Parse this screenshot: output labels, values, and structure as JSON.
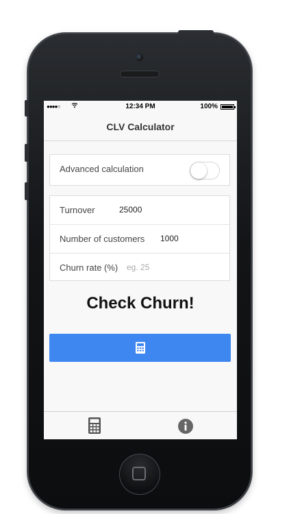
{
  "status_bar": {
    "signal": "●●●●○",
    "time": "12:34 PM",
    "battery": "100%"
  },
  "nav": {
    "title": "CLV Calculator"
  },
  "advanced": {
    "label": "Advanced calculation",
    "enabled": false
  },
  "form": {
    "turnover": {
      "label": "Turnover",
      "value": "25000"
    },
    "customers": {
      "label": "Number of customers",
      "value": "1000"
    },
    "churn": {
      "label": "Churn rate (%)",
      "value": "",
      "placeholder": "eg. 25"
    }
  },
  "headline": "Check Churn!",
  "colors": {
    "accent": "#3f87f0",
    "tab_icon": "#555555"
  },
  "icons": {
    "calc_button": "calculator-icon",
    "tab_calculator": "calculator-icon",
    "tab_info": "info-icon"
  }
}
